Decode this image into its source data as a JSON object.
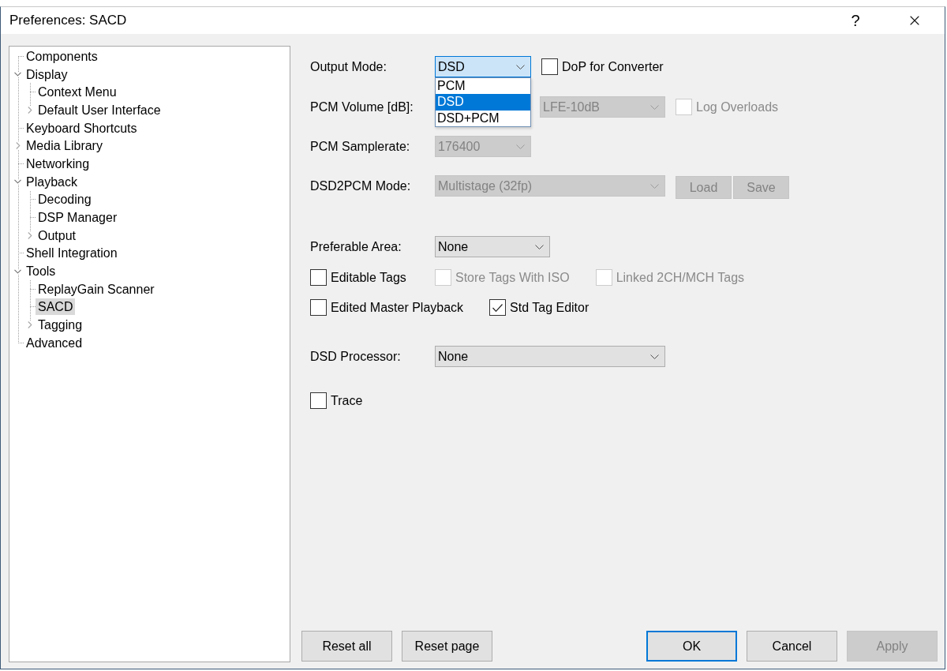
{
  "window": {
    "title": "Preferences: SACD",
    "help": "?"
  },
  "tree": [
    {
      "label": "Components",
      "kind": "leaf",
      "selected": false
    },
    {
      "label": "Display",
      "kind": "group",
      "expanded": true,
      "selected": false,
      "children": [
        {
          "label": "Context Menu",
          "kind": "leaf",
          "selected": false
        },
        {
          "label": "Default User Interface",
          "kind": "group",
          "expanded": false,
          "selected": false
        }
      ]
    },
    {
      "label": "Keyboard Shortcuts",
      "kind": "leaf",
      "selected": false
    },
    {
      "label": "Media Library",
      "kind": "group",
      "expanded": false,
      "selected": false
    },
    {
      "label": "Networking",
      "kind": "leaf",
      "selected": false
    },
    {
      "label": "Playback",
      "kind": "group",
      "expanded": true,
      "selected": false,
      "children": [
        {
          "label": "Decoding",
          "kind": "leaf",
          "selected": false
        },
        {
          "label": "DSP Manager",
          "kind": "leaf",
          "selected": false
        },
        {
          "label": "Output",
          "kind": "group",
          "expanded": false,
          "selected": false
        }
      ]
    },
    {
      "label": "Shell Integration",
      "kind": "leaf",
      "selected": false
    },
    {
      "label": "Tools",
      "kind": "group",
      "expanded": true,
      "selected": false,
      "children": [
        {
          "label": "ReplayGain Scanner",
          "kind": "leaf",
          "selected": false
        },
        {
          "label": "SACD",
          "kind": "leaf",
          "selected": true
        },
        {
          "label": "Tagging",
          "kind": "group",
          "expanded": false,
          "selected": false
        }
      ]
    },
    {
      "label": "Advanced",
      "kind": "leaf",
      "selected": false
    }
  ],
  "output_mode": {
    "label": "Output Mode:",
    "select": {
      "value": "DSD",
      "focused": true,
      "disabled": false
    },
    "options": [
      {
        "label": "PCM",
        "selected": false
      },
      {
        "label": "DSD",
        "selected": true
      },
      {
        "label": "DSD+PCM",
        "selected": false
      }
    ],
    "dop": {
      "label": "DoP for Converter",
      "checked": false,
      "disabled": false
    }
  },
  "pcm_volume": {
    "label": "PCM Volume [dB]:",
    "lfe": {
      "value": "LFE-10dB",
      "disabled": true
    },
    "log_overloads": {
      "label": "Log Overloads",
      "checked": false,
      "disabled": true
    }
  },
  "pcm_samplerate": {
    "label": "PCM Samplerate:",
    "select": {
      "value": "176400",
      "disabled": true
    }
  },
  "dsd2pcm_mode": {
    "label": "DSD2PCM Mode:",
    "select": {
      "value": "Multistage (32fp)",
      "disabled": true
    },
    "buttons": [
      {
        "label": "Load",
        "disabled": true
      },
      {
        "label": "Save",
        "disabled": true
      }
    ]
  },
  "preferable_area": {
    "label": "Preferable Area:",
    "select": {
      "value": "None",
      "disabled": false
    }
  },
  "tag_option_rows": [
    {
      "items": [
        {
          "label": "Editable Tags",
          "checked": false,
          "disabled": false
        },
        {
          "label": "Store Tags With ISO",
          "checked": false,
          "disabled": true
        },
        {
          "label": "Linked 2CH/MCH Tags",
          "checked": false,
          "disabled": true
        }
      ]
    },
    {
      "items": [
        {
          "label": "Edited Master Playback",
          "checked": false,
          "disabled": false
        },
        {
          "label": "Std Tag Editor",
          "checked": true,
          "disabled": false
        }
      ]
    }
  ],
  "dsd_processor": {
    "label": "DSD Processor:",
    "select": {
      "value": "None",
      "disabled": false
    }
  },
  "trace": {
    "label": "Trace",
    "checked": false,
    "disabled": false
  },
  "footer": {
    "left": [
      {
        "label": "Reset all",
        "disabled": false,
        "default": false
      },
      {
        "label": "Reset page",
        "disabled": false,
        "default": false
      }
    ],
    "right": [
      {
        "label": "OK",
        "disabled": false,
        "default": true
      },
      {
        "label": "Cancel",
        "disabled": false,
        "default": false
      },
      {
        "label": "Apply",
        "disabled": true,
        "default": false
      }
    ]
  }
}
